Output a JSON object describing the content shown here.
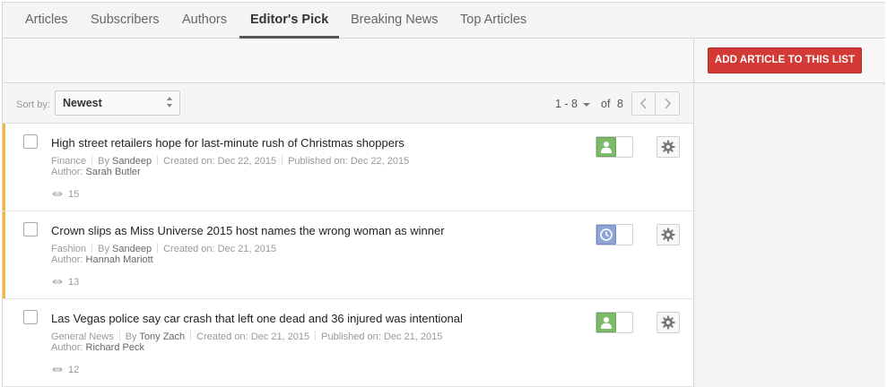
{
  "tabs": [
    {
      "label": "Articles",
      "active": false
    },
    {
      "label": "Subscribers",
      "active": false
    },
    {
      "label": "Authors",
      "active": false
    },
    {
      "label": "Editor's Pick",
      "active": true
    },
    {
      "label": "Breaking News",
      "active": false
    },
    {
      "label": "Top Articles",
      "active": false
    }
  ],
  "toolbar": {
    "add_button_label": "ADD ARTICLE TO THIS LIST"
  },
  "sort": {
    "label": "Sort by:",
    "selected": "Newest"
  },
  "pager": {
    "range": "1 - 8",
    "of_label": "of",
    "total": "8"
  },
  "meta_labels": {
    "by": "By",
    "created": "Created on:",
    "published": "Published on:",
    "author": "Author:"
  },
  "articles": [
    {
      "title": "High street retailers hope for last-minute rush of Christmas shoppers",
      "category": "Finance",
      "by": "Sandeep",
      "created": "Dec 22, 2015",
      "published": "Dec 22, 2015",
      "author": "Sarah Butler",
      "views": "15",
      "status_icon": "user-icon",
      "status_color": "#7dbb6a"
    },
    {
      "title": "Crown slips as Miss Universe 2015 host names the wrong woman as winner",
      "category": "Fashion",
      "by": "Sandeep",
      "created": "Dec 21, 2015",
      "published": null,
      "author": "Hannah Mariott",
      "views": "13",
      "status_icon": "clock-icon",
      "status_color": "#8ea5d8"
    },
    {
      "title": "Las Vegas police say car crash that left one dead and 36 injured was intentional",
      "category": "General News",
      "by": "Tony Zach",
      "created": "Dec 21, 2015",
      "published": "Dec 21, 2015",
      "author": "Richard Peck",
      "views": "12",
      "status_icon": "user-icon",
      "status_color": "#7dbb6a"
    }
  ],
  "colors": {
    "accent_bar": "#f0b73c",
    "primary_button": "#d33a35"
  }
}
